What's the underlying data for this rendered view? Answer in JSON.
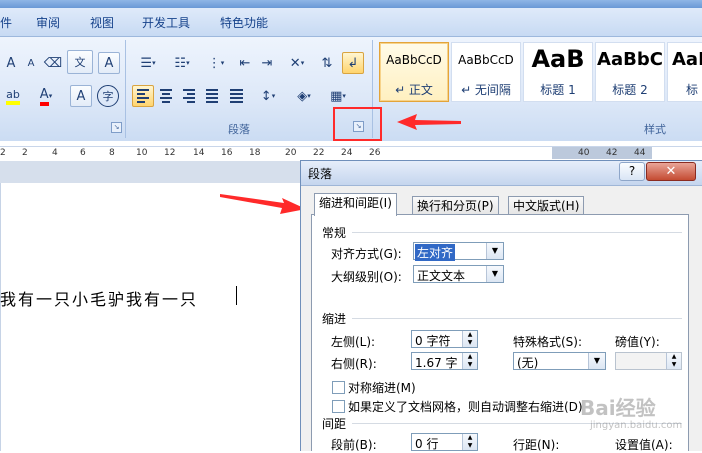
{
  "window": {
    "title": ""
  },
  "tabs": [
    {
      "label": "件"
    },
    {
      "label": "审阅"
    },
    {
      "label": "视图"
    },
    {
      "label": "开发工具"
    },
    {
      "label": "特色功能"
    }
  ],
  "ribbon": {
    "font_buttons": {
      "grow": "A",
      "wen": "文",
      "border_char": "A",
      "circle_char": "字"
    },
    "groups": [
      {
        "label": "段落"
      },
      {
        "label": "样式"
      }
    ],
    "styles": [
      {
        "sample": "AaBbCcD",
        "name": "↵ 正文"
      },
      {
        "sample": "AaBbCcD",
        "name": "↵ 无间隔"
      },
      {
        "sample": "AaB",
        "name": "标题 1"
      },
      {
        "sample": "AaBbC",
        "name": "标题 2"
      },
      {
        "sample": "AaI",
        "name": "标"
      }
    ]
  },
  "ruler": {
    "numbers": [
      "2",
      "2",
      "4",
      "6",
      "8",
      "10",
      "12",
      "14",
      "16",
      "18",
      "20",
      "22",
      "24",
      "26",
      "40",
      "42",
      "44"
    ]
  },
  "document": {
    "text": "我有一只小毛驴我有一只"
  },
  "dialog": {
    "title": "段落",
    "help": "?",
    "close": "✕",
    "tabs": [
      {
        "label": "缩进和间距(I)"
      },
      {
        "label": "换行和分页(P)"
      },
      {
        "label": "中文版式(H)"
      }
    ],
    "general": {
      "title": "常规",
      "alignment_label": "对齐方式(G):",
      "alignment_value": "左对齐",
      "outline_label": "大纲级别(O):",
      "outline_value": "正文文本"
    },
    "indent": {
      "title": "缩进",
      "left_label": "左侧(L):",
      "left_value": "0 字符",
      "right_label": "右侧(R):",
      "right_value": "1.67 字",
      "special_label": "特殊格式(S):",
      "special_value": "(无)",
      "by_label": "磅值(Y):",
      "by_value": "",
      "mirror_label": "对称缩进(M)",
      "grid_label": "如果定义了文档网格，则自动调整右缩进(D)"
    },
    "spacing": {
      "title": "间距",
      "before_label": "段前(B):",
      "before_value": "0 行",
      "line_label": "行距(N):",
      "at_label": "设置值(A):"
    }
  },
  "watermark": {
    "brand": "经验",
    "url": "jingyan.baidu.com"
  },
  "colors": {
    "annotation": "#ff2a2a",
    "highlight": "#ffff00",
    "font_color": "#ff0000"
  }
}
